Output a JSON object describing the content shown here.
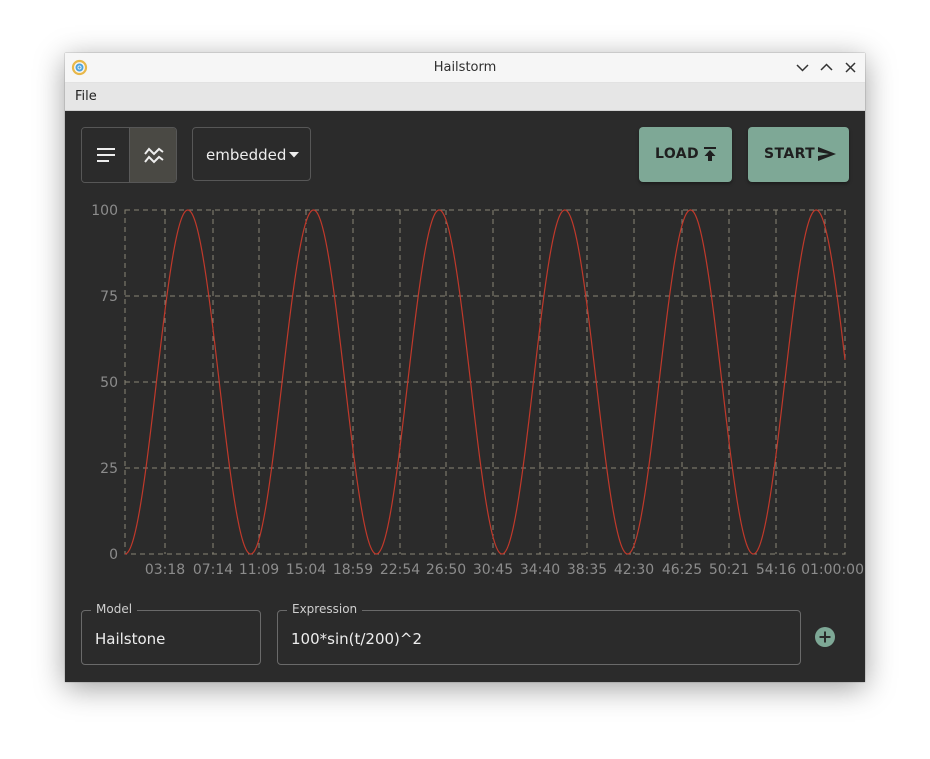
{
  "window": {
    "title": "Hailstorm",
    "controls": [
      "minimize-icon",
      "maximize-icon",
      "close-icon"
    ]
  },
  "menu": {
    "items": [
      {
        "label": "File"
      }
    ]
  },
  "toolbar": {
    "view_toggle": {
      "options": [
        {
          "icon": "list-icon",
          "selected": false
        },
        {
          "icon": "waveform-icon",
          "selected": true
        }
      ]
    },
    "mode_select": {
      "value": "embedded",
      "icon": "caret-down-icon"
    },
    "load_button": {
      "label": "LOAD",
      "icon": "upload-icon"
    },
    "start_button": {
      "label": "START",
      "icon": "send-icon"
    }
  },
  "chart_data": {
    "type": "line",
    "title": "",
    "xlabel": "",
    "ylabel": "",
    "ylim": [
      0,
      100
    ],
    "xlim": [
      "00:00",
      "01:00:00"
    ],
    "yticks": [
      0,
      25,
      50,
      75,
      100
    ],
    "xticks": [
      "03:18",
      "07:14",
      "11:09",
      "15:04",
      "18:59",
      "22:54",
      "26:50",
      "30:45",
      "34:40",
      "38:35",
      "42:30",
      "46:25",
      "50:21",
      "54:16",
      "01:00:00"
    ],
    "grid": true,
    "series": [
      {
        "name": "",
        "expression": "100*sin(t/200)^2",
        "x_seconds_start": 0,
        "x_seconds_end": 3600,
        "color": "#c0392b"
      }
    ]
  },
  "colors": {
    "background": "#2b2b2b",
    "accent": "#7ea896",
    "grid": "#8a8676",
    "series": "#c0392b",
    "tick_label": "#8c8c8c"
  },
  "inputs": {
    "model": {
      "label": "Model",
      "value": "Hailstone"
    },
    "expression": {
      "label": "Expression",
      "value": "100*sin(t/200)^2"
    }
  },
  "add_button": {
    "icon": "add-circle-icon"
  }
}
